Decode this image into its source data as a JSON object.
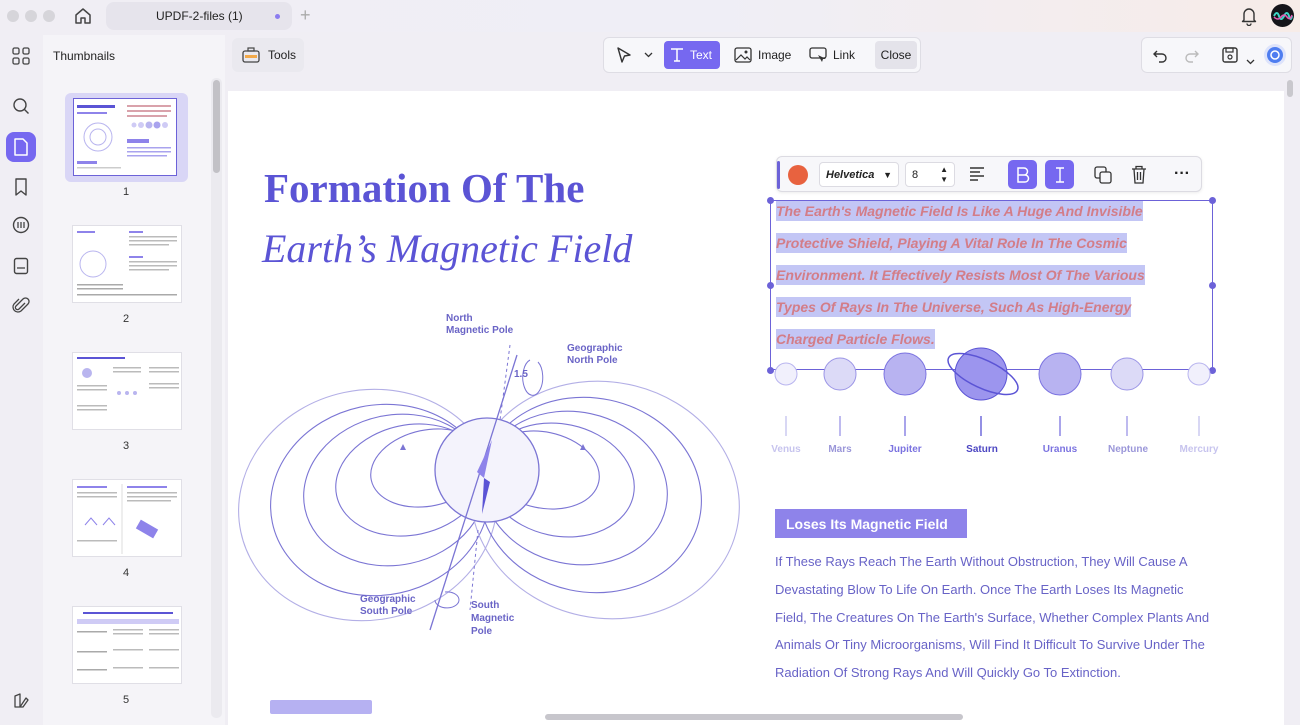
{
  "window": {
    "tab_title": "UPDF-2-files (1)"
  },
  "sidebar": {
    "title": "Thumbnails",
    "pages": [
      "1",
      "2",
      "3",
      "4",
      "5"
    ]
  },
  "toolbar": {
    "tools_label": "Tools",
    "text_label": "Text",
    "image_label": "Image",
    "link_label": "Link",
    "close_label": "Close"
  },
  "format_bar": {
    "color": "#e8623f",
    "font": "Helvetica",
    "size": "8"
  },
  "document": {
    "title_line1": "Formation Of The",
    "title_line2": "Earth’s Magnetic Field",
    "selected_lines": [
      "The Earth's Magnetic Field Is Like A Huge And Invisible",
      "Protective Shield, Playing A Vital Role In The Cosmic",
      "Environment. It Effectively Resists Most Of The Various",
      "Types Of Rays In The Universe, Such As High-Energy",
      "Charged Particle Flows."
    ],
    "planets": [
      "Venus",
      "Mars",
      "Jupiter",
      "Saturn",
      "Uranus",
      "Neptune",
      "Mercury"
    ],
    "diagram_labels": {
      "north_magnetic_1": "North",
      "north_magnetic_2": "Magnetic Pole",
      "geo_north_1": "Geographic",
      "geo_north_2": "North Pole",
      "angle": "1.5",
      "geo_south_1": "Geographic",
      "geo_south_2": "South Pole",
      "south_magnetic_1": "South",
      "south_magnetic_2": "Magnetic",
      "south_magnetic_3": "Pole"
    },
    "section_heading": "Loses Its Magnetic Field",
    "section_lines": [
      "If These Rays Reach The Earth Without Obstruction, They Will Cause A",
      "Devastating Blow To Life On Earth. Once The Earth Loses Its Magnetic",
      "Field, The Creatures On The Earth's Surface, Whether Complex Plants And",
      "Animals Or Tiny Microorganisms, Will Find It Difficult To Survive Under The",
      "Radiation Of Strong Rays And Will Quickly Go To Extinction."
    ]
  },
  "colors": {
    "accent": "#7668f0",
    "title": "#5b54d5",
    "highlight": "#c3c6f5",
    "selected_text": "#d37d88"
  }
}
